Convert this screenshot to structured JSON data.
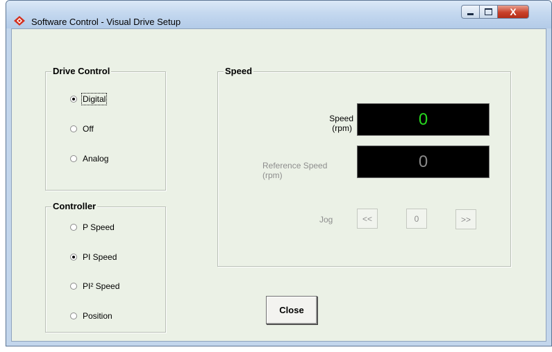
{
  "window": {
    "title": "Software Control - Visual Drive Setup",
    "controls": {
      "minimize": "",
      "maximize": "",
      "close": "X"
    }
  },
  "drive_control": {
    "title": "Drive Control",
    "options": [
      {
        "label": "Digital",
        "selected": true
      },
      {
        "label": "Off",
        "selected": false
      },
      {
        "label": "Analog",
        "selected": false
      }
    ]
  },
  "controller": {
    "title": "Controller",
    "options": [
      {
        "label": "P Speed",
        "selected": false
      },
      {
        "label": "PI Speed",
        "selected": true
      },
      {
        "label": "PI² Speed",
        "selected": false
      },
      {
        "label": "Position",
        "selected": false
      }
    ]
  },
  "speed": {
    "title": "Speed",
    "speed_label_line1": "Speed",
    "speed_label_line2": "(rpm)",
    "speed_value": "0",
    "speed_color": "#27d91f",
    "reference_label_line1": "Reference Speed",
    "reference_label_line2": "(rpm)",
    "reference_value": "0",
    "reference_color": "#8a8a8a",
    "jog_label": "Jog",
    "jog_back": "<<",
    "jog_stop": "0",
    "jog_forward": ">>"
  },
  "close_button": "Close",
  "colors": {
    "client_bg": "#ebf1e6",
    "title_bg": "#c4d8ef",
    "close_red": "#c9412a"
  }
}
